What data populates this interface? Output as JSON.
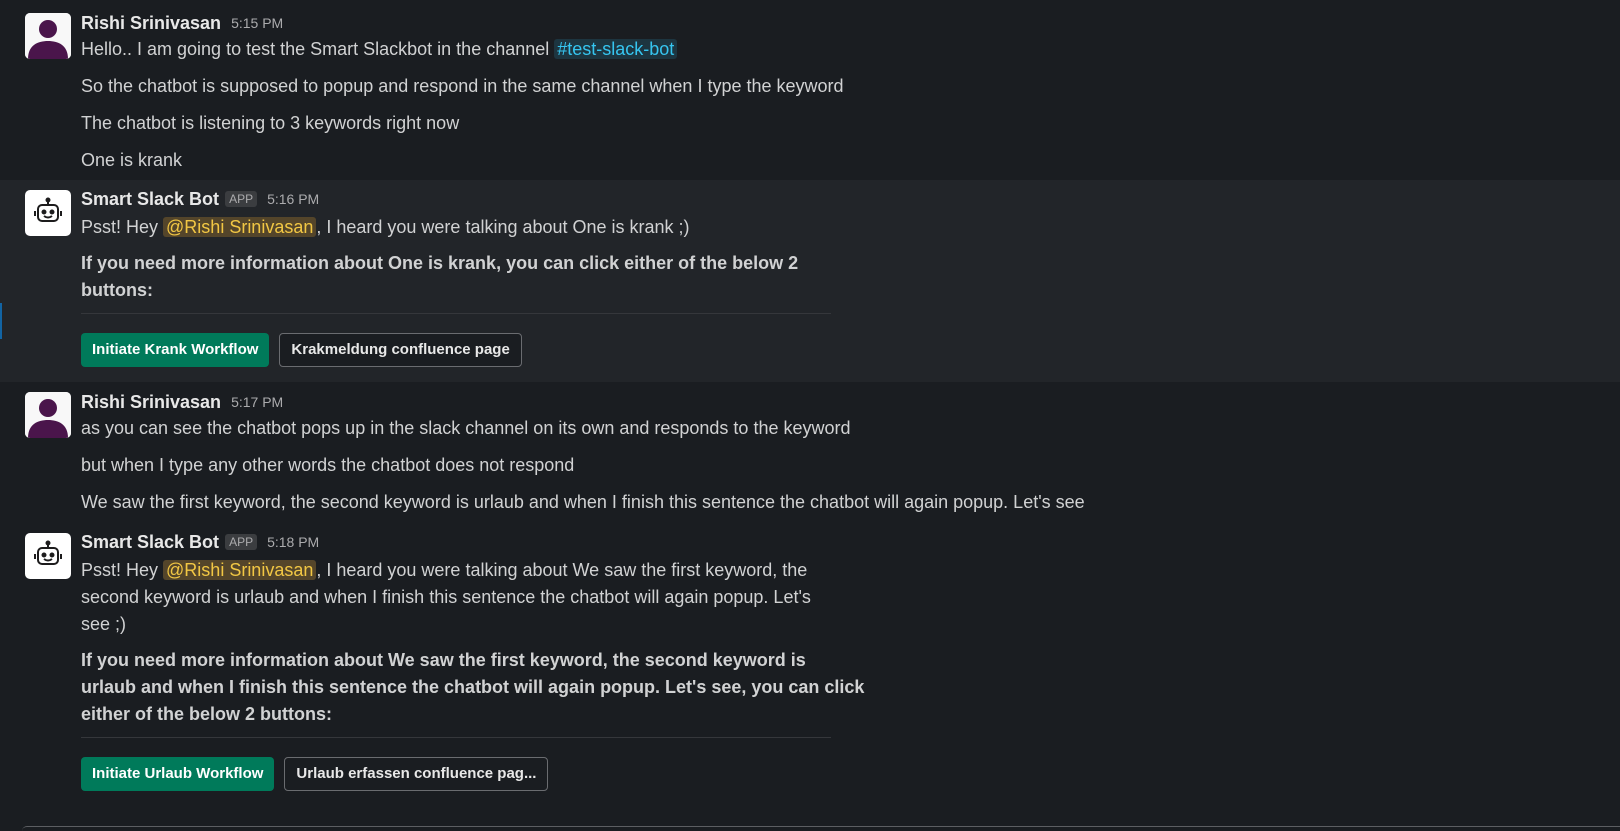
{
  "messages": [
    {
      "author": "Rishi Srinivasan",
      "time": "5:15 PM",
      "line1_prefix": "Hello.. I am going to test the Smart Slackbot in the channel ",
      "channel": "#test-slack-bot",
      "line2": "So the chatbot is supposed to popup and respond in the same channel when I type the keyword",
      "line3": "The chatbot is listening to 3 keywords right now",
      "line4": "One is krank"
    },
    {
      "author": "Smart Slack Bot",
      "badge": "APP",
      "time": "5:16 PM",
      "psst": "Psst! Hey ",
      "mention": "@Rishi Srinivasan",
      "psst_suffix": ", I heard you were talking about One is krank ;)",
      "info_line1": "If you need more information about One is krank, you can click either of the below 2",
      "info_line2": "buttons:",
      "button_primary": "Initiate Krank Workflow",
      "button_secondary": "Krakmeldung confluence page"
    },
    {
      "author": "Rishi Srinivasan",
      "time": "5:17 PM",
      "line1": "as you can see the chatbot pops up in the slack channel on its own and responds to the keyword",
      "line2": "but when I type any other words the chatbot does not respond",
      "line3": "We saw the first keyword, the second keyword is urlaub and when I finish this sentence the chatbot will again popup. Let's see"
    },
    {
      "author": "Smart Slack Bot",
      "badge": "APP",
      "time": "5:18 PM",
      "psst": "Psst! Hey ",
      "mention": "@Rishi Srinivasan",
      "psst_suffix1": ", I heard you were talking about We saw the first keyword, the",
      "psst_line2": "second keyword is urlaub and when I finish this sentence the chatbot will again popup. Let's",
      "psst_line3": "see ;)",
      "info_line1": "If you need more information about We saw the first keyword, the second keyword is",
      "info_line2": "urlaub and when I finish this sentence the chatbot will again popup. Let's see, you can click",
      "info_line3": "either of the below 2 buttons:",
      "button_primary": "Initiate Urlaub Workflow",
      "button_secondary": "Urlaub erfassen confluence pag..."
    }
  ],
  "icons": {
    "user_avatar": "user-avatar-icon",
    "bot_avatar": "robot-icon"
  },
  "colors": {
    "background": "#1a1d21",
    "primary_button": "#007a5a",
    "mention": "#f2c744",
    "channel": "#36c5f0"
  }
}
